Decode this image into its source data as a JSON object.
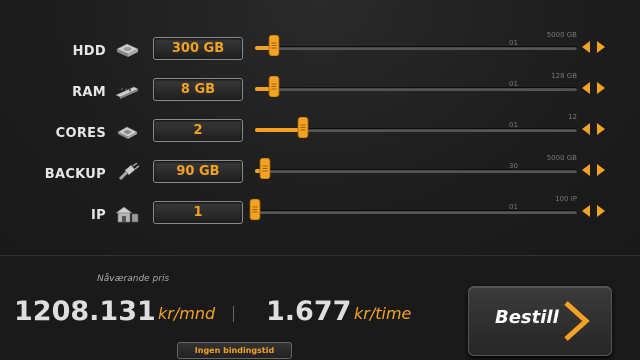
{
  "resources": [
    {
      "key": "hdd",
      "label": "HDD",
      "icon": "hard-drive-icon",
      "value": "300 GB",
      "min_label": "01",
      "max_label": "5000 GB",
      "level": 0.06
    },
    {
      "key": "ram",
      "label": "RAM",
      "icon": "memory-icon",
      "value": "8 GB",
      "min_label": "01",
      "max_label": "128 GB",
      "level": 0.06
    },
    {
      "key": "cores",
      "label": "CORES",
      "icon": "cpu-chip-icon",
      "value": "2",
      "min_label": "01",
      "max_label": "12",
      "level": 0.15
    },
    {
      "key": "backup",
      "label": "BACKUP",
      "icon": "backup-plug-icon",
      "value": "90 GB",
      "min_label": "30",
      "max_label": "5000 GB",
      "level": 0.03
    },
    {
      "key": "ip",
      "label": "IP",
      "icon": "network-house-icon",
      "value": "1",
      "min_label": "01",
      "max_label": "100 IP",
      "level": 0.0
    }
  ],
  "price": {
    "title": "Nåværande pris",
    "monthly_value": "1208.131",
    "monthly_unit": "kr/mnd",
    "hourly_value": "1.677",
    "hourly_unit": "kr/time",
    "binding_label": "Ingen bindingstid"
  },
  "order_button": {
    "label": "Bestill",
    "icon": "chevron-right-icon"
  },
  "colors": {
    "accent": "#f3a223",
    "background": "#1c1c1c",
    "text": "#dedede"
  }
}
